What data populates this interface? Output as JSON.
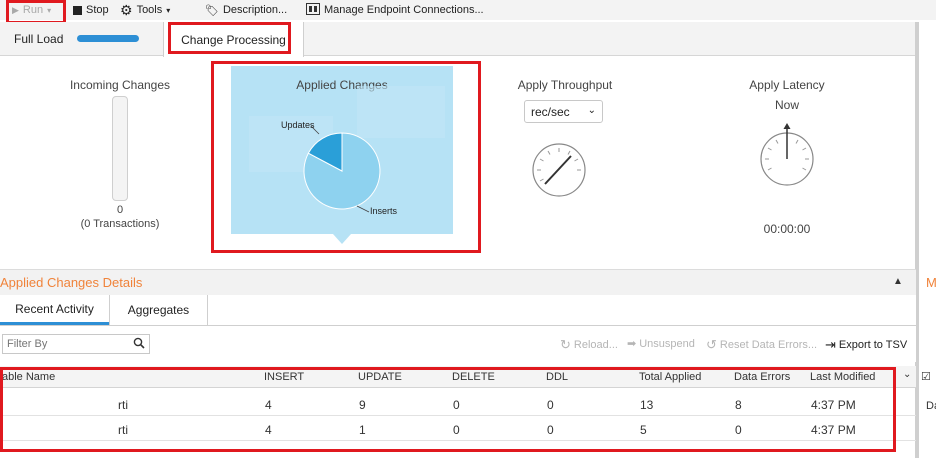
{
  "toolbar": {
    "run_label": "Run",
    "stop_label": "Stop",
    "tools_label": "Tools",
    "description_label": "Description...",
    "manage_endpoints_label": "Manage Endpoint Connections..."
  },
  "tabs": {
    "full_load": "Full Load",
    "change_processing": "Change Processing"
  },
  "incoming": {
    "title": "Incoming Changes",
    "count": "0",
    "transactions": "(0 Transactions)"
  },
  "applied": {
    "title": "Applied Changes",
    "slices": [
      {
        "label": "Updates",
        "color": "#2a9fd8"
      },
      {
        "label": "Inserts",
        "color": "#8ed2ef"
      }
    ]
  },
  "throughput": {
    "title": "Apply Throughput",
    "unit_selected": "rec/sec"
  },
  "latency": {
    "title": "Apply Latency",
    "subtitle": "Now",
    "time": "00:00:00"
  },
  "details": {
    "title": "Applied Changes Details",
    "subtabs": [
      "Recent Activity",
      "Aggregates"
    ],
    "filter_placeholder": "Filter By",
    "actions": {
      "reload": "Reload...",
      "unsuspend": "Unsuspend",
      "reset": "Reset Data Errors...",
      "export": "Export to TSV"
    },
    "columns": [
      "able Name",
      "INSERT",
      "UPDATE",
      "DELETE",
      "DDL",
      "Total Applied",
      "Data Errors",
      "Last Modified"
    ],
    "rows": [
      [
        "rti",
        "4",
        "9",
        "0",
        "0",
        "13",
        "8",
        "4:37 PM"
      ],
      [
        "rti",
        "4",
        "1",
        "0",
        "0",
        "5",
        "0",
        "4:37 PM"
      ]
    ]
  },
  "side_panel": {
    "title_cut": "M",
    "row_cut": "Da"
  }
}
